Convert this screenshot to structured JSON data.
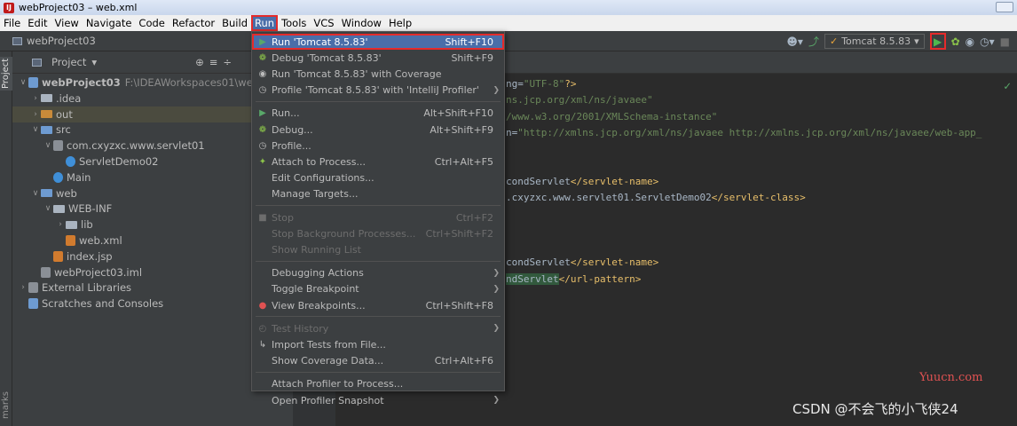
{
  "window": {
    "title": "webProject03 – web.xml",
    "app_icon": "IJ"
  },
  "menubar": {
    "items": [
      "File",
      "Edit",
      "View",
      "Navigate",
      "Code",
      "Refactor",
      "Build",
      "Run",
      "Tools",
      "VCS",
      "Window",
      "Help"
    ],
    "active": "Run"
  },
  "navbar": {
    "project": "webProject03"
  },
  "toolbar": {
    "run_config": "Tomcat 8.5.83"
  },
  "side_tabs": {
    "project": "Project",
    "bookmarks": "marks"
  },
  "project_panel": {
    "header": "Project",
    "tree": [
      {
        "label": "webProject03",
        "suffix": "F:\\IDEAWorkspaces01\\webP",
        "level": 0,
        "arrow": "down",
        "kind": "module"
      },
      {
        "label": ".idea",
        "level": 1,
        "arrow": "right",
        "kind": "folder"
      },
      {
        "label": "out",
        "level": 1,
        "arrow": "right",
        "kind": "folder-orange",
        "selected": true
      },
      {
        "label": "src",
        "level": 1,
        "arrow": "down",
        "kind": "folder-blue"
      },
      {
        "label": "com.cxyzxc.www.servlet01",
        "level": 2,
        "arrow": "down",
        "kind": "package"
      },
      {
        "label": "ServletDemo02",
        "level": 3,
        "arrow": "",
        "kind": "class"
      },
      {
        "label": "Main",
        "level": 2,
        "arrow": "",
        "kind": "class"
      },
      {
        "label": "web",
        "level": 1,
        "arrow": "down",
        "kind": "folder-blue"
      },
      {
        "label": "WEB-INF",
        "level": 2,
        "arrow": "down",
        "kind": "folder"
      },
      {
        "label": "lib",
        "level": 3,
        "arrow": "right",
        "kind": "folder"
      },
      {
        "label": "web.xml",
        "level": 3,
        "arrow": "",
        "kind": "xml"
      },
      {
        "label": "index.jsp",
        "level": 2,
        "arrow": "",
        "kind": "jsp"
      },
      {
        "label": "webProject03.iml",
        "level": 1,
        "arrow": "",
        "kind": "iml"
      },
      {
        "label": "External Libraries",
        "level": 0,
        "arrow": "right",
        "kind": "libs"
      },
      {
        "label": "Scratches and Consoles",
        "level": 0,
        "arrow": "",
        "kind": "scratch"
      }
    ]
  },
  "editor": {
    "lines": [
      {
        "parts": [
          {
            "t": "ng=",
            "c": ""
          },
          {
            "t": "\"UTF-8\"",
            "c": "str"
          },
          {
            "t": "?>",
            "c": "tag"
          }
        ]
      },
      {
        "parts": [
          {
            "t": "ns.jcp.org/xml/ns/javaee\"",
            "c": "str"
          }
        ]
      },
      {
        "parts": [
          {
            "t": "/www.w3.org/2001/XMLSchema-instance\"",
            "c": "str"
          }
        ]
      },
      {
        "parts": [
          {
            "t": "n=",
            "c": ""
          },
          {
            "t": "\"http://xmlns.jcp.org/xml/ns/javaee http://xmlns.jcp.org/xml/ns/javaee/web-app_",
            "c": "str"
          }
        ]
      },
      {
        "parts": []
      },
      {
        "parts": []
      },
      {
        "parts": [
          {
            "t": "condServlet",
            "c": ""
          },
          {
            "t": "</servlet-name>",
            "c": "tag"
          }
        ]
      },
      {
        "parts": [
          {
            "t": ".cxyzxc.www.servlet01.ServletDemo02",
            "c": ""
          },
          {
            "t": "</servlet-class>",
            "c": "tag"
          }
        ]
      },
      {
        "parts": []
      },
      {
        "parts": []
      },
      {
        "parts": []
      },
      {
        "parts": [
          {
            "t": "condServlet",
            "c": ""
          },
          {
            "t": "</servlet-name>",
            "c": "tag"
          }
        ]
      },
      {
        "parts": [
          {
            "t": "ndServlet",
            "c": "hl"
          },
          {
            "t": "</url-pattern>",
            "c": "tag"
          }
        ]
      }
    ]
  },
  "run_menu": {
    "items": [
      {
        "label": "Run 'Tomcat 8.5.83'",
        "shortcut": "Shift+F10",
        "icon": "run-icon",
        "state": "highlighted"
      },
      {
        "label": "Debug 'Tomcat 8.5.83'",
        "shortcut": "Shift+F9",
        "icon": "debug-icon"
      },
      {
        "label": "Run 'Tomcat 8.5.83' with Coverage",
        "shortcut": "",
        "icon": "coverage-icon"
      },
      {
        "label": "Profile 'Tomcat 8.5.83' with 'IntelliJ Profiler'",
        "shortcut": "",
        "icon": "profile-icon",
        "submenu": true
      },
      {
        "sep": true
      },
      {
        "label": "Run...",
        "shortcut": "Alt+Shift+F10",
        "icon": "run-icon"
      },
      {
        "label": "Debug...",
        "shortcut": "Alt+Shift+F9",
        "icon": "debug-icon"
      },
      {
        "label": "Profile...",
        "shortcut": "",
        "icon": "profile-icon"
      },
      {
        "label": "Attach to Process...",
        "shortcut": "Ctrl+Alt+F5",
        "icon": "attach-icon"
      },
      {
        "label": "Edit Configurations...",
        "shortcut": ""
      },
      {
        "label": "Manage Targets...",
        "shortcut": ""
      },
      {
        "sep": true
      },
      {
        "label": "Stop",
        "shortcut": "Ctrl+F2",
        "icon": "stop-icon",
        "state": "disabled"
      },
      {
        "label": "Stop Background Processes...",
        "shortcut": "Ctrl+Shift+F2",
        "state": "disabled"
      },
      {
        "label": "Show Running List",
        "shortcut": "",
        "state": "disabled"
      },
      {
        "sep": true
      },
      {
        "label": "Debugging Actions",
        "shortcut": "",
        "submenu": true
      },
      {
        "label": "Toggle Breakpoint",
        "shortcut": "",
        "submenu": true
      },
      {
        "label": "View Breakpoints...",
        "shortcut": "Ctrl+Shift+F8",
        "icon": "breakpoint-icon"
      },
      {
        "sep": true
      },
      {
        "label": "Test History",
        "shortcut": "",
        "icon": "history-icon",
        "state": "disabled",
        "submenu": true
      },
      {
        "label": "Import Tests from File...",
        "shortcut": "",
        "icon": "import-icon"
      },
      {
        "label": "Show Coverage Data...",
        "shortcut": "Ctrl+Alt+F6"
      },
      {
        "sep": true
      },
      {
        "label": "Attach Profiler to Process...",
        "shortcut": ""
      },
      {
        "label": "Open Profiler Snapshot",
        "shortcut": "",
        "submenu": true
      }
    ]
  },
  "watermarks": {
    "site": "Yuucn.com",
    "author": "CSDN @不会飞的小飞侠24"
  },
  "colors": {
    "highlight": "#4a6ea9",
    "annotation_red": "#e52b2b",
    "run_green": "#4fb84f"
  }
}
